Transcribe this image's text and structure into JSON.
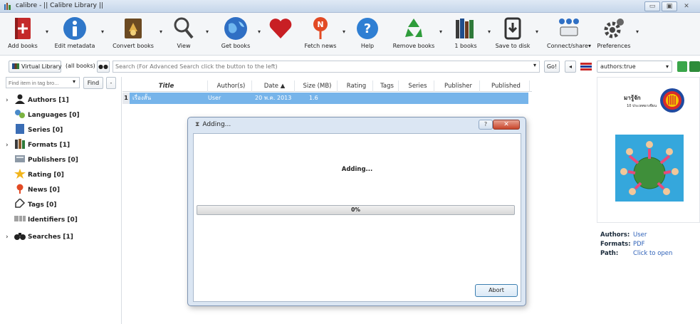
{
  "window": {
    "title": "calibre - || Calibre Library ||",
    "controls": [
      "▭",
      "▣",
      "✕"
    ]
  },
  "toolbar": {
    "items": [
      {
        "label": "Add books",
        "icon": "add-books-icon"
      },
      {
        "label": "Edit metadata",
        "icon": "info-icon"
      },
      {
        "label": "Convert books",
        "icon": "convert-icon"
      },
      {
        "label": "View",
        "icon": "magnifier-icon"
      },
      {
        "label": "Get books",
        "icon": "globe-icon"
      },
      {
        "label": "",
        "icon": "heart-icon"
      },
      {
        "label": "Fetch news",
        "icon": "news-icon"
      },
      {
        "label": "Help",
        "icon": "help-icon"
      },
      {
        "label": "Remove books",
        "icon": "recycle-icon"
      },
      {
        "label": "1 books",
        "icon": "library-icon"
      },
      {
        "label": "Save to disk",
        "icon": "save-icon"
      },
      {
        "label": "Connect/share▾",
        "icon": "connect-icon"
      },
      {
        "label": "Preferences",
        "icon": "gear-icon"
      }
    ],
    "arrow": "▾"
  },
  "search": {
    "virtual_library": "Virtual Library",
    "all_books": "(all books)",
    "placeholder": "Search (For Advanced Search click the button to the left)",
    "go": "Go!",
    "saved_search": "authors:true"
  },
  "tag_browser": {
    "find_placeholder": "Find item in tag bro...",
    "find_button": "Find",
    "minus": "-",
    "items": [
      {
        "label": "Authors [1]",
        "expand": "›",
        "icon": "person-icon"
      },
      {
        "label": "Languages [0]",
        "expand": "",
        "icon": "languages-icon"
      },
      {
        "label": "Series [0]",
        "expand": "",
        "icon": "series-icon"
      },
      {
        "label": "Formats [1]",
        "expand": "›",
        "icon": "formats-icon"
      },
      {
        "label": "Publishers [0]",
        "expand": "",
        "icon": "publisher-icon"
      },
      {
        "label": "Rating [0]",
        "expand": "",
        "icon": "star-icon"
      },
      {
        "label": "News [0]",
        "expand": "",
        "icon": "pin-icon"
      },
      {
        "label": "Tags [0]",
        "expand": "",
        "icon": "tag-icon"
      },
      {
        "label": "Identifiers [0]",
        "expand": "",
        "icon": "barcode-icon"
      },
      {
        "label": "Searches [1]",
        "expand": "›",
        "icon": "binoculars-icon"
      }
    ]
  },
  "book_list": {
    "columns": [
      "Title",
      "Author(s)",
      "Date ▲",
      "Size (MB)",
      "Rating",
      "Tags",
      "Series",
      "Publisher",
      "Published"
    ],
    "rows": [
      {
        "num": "1",
        "title": "เรื่องสั้น",
        "author": "User",
        "date": "20 พ.ค. 2013",
        "size": "1.6"
      }
    ]
  },
  "details": {
    "authors_key": "Authors:",
    "authors_val": "User",
    "formats_key": "Formats:",
    "formats_val": "PDF",
    "path_key": "Path:",
    "path_val": "Click to open",
    "cover_title": "มารู้จัก",
    "cover_subtitle": "10 ประเทศอาเซียน"
  },
  "dialog": {
    "title": "Adding...",
    "message": "Adding...",
    "progress_text": "0%",
    "progress": 0,
    "help": "?",
    "close": "✕",
    "abort": "Abort"
  }
}
